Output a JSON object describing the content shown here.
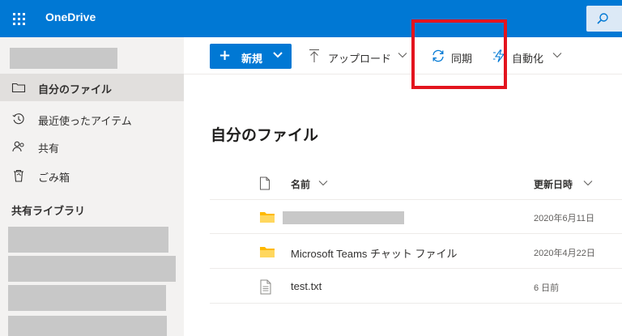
{
  "header": {
    "app_name": "OneDrive"
  },
  "sidebar": {
    "items": [
      {
        "label": "自分のファイル",
        "icon": "folder-icon",
        "active": true
      },
      {
        "label": "最近使ったアイテム",
        "icon": "history-icon",
        "active": false
      },
      {
        "label": "共有",
        "icon": "people-icon",
        "active": false
      },
      {
        "label": "ごみ箱",
        "icon": "trash-icon",
        "active": false
      }
    ],
    "shared_libraries_title": "共有ライブラリ"
  },
  "command_bar": {
    "new_label": "新規",
    "upload_label": "アップロード",
    "sync_label": "同期",
    "automate_label": "自動化"
  },
  "main": {
    "title": "自分のファイル",
    "columns": {
      "name": "名前",
      "modified": "更新日時"
    },
    "rows": [
      {
        "name": "",
        "date": "2020年6月11日",
        "type": "folder",
        "redacted": true
      },
      {
        "name": "Microsoft Teams チャット ファイル",
        "date": "2020年4月22日",
        "type": "folder",
        "redacted": false
      },
      {
        "name": "test.txt",
        "date": "6 日前",
        "type": "text-file",
        "redacted": false
      }
    ]
  },
  "colors": {
    "brand_blue": "#0078d4",
    "sidebar_bg": "#f3f2f1",
    "highlight_red": "#e3141e",
    "folder_yellow": "#ffb900"
  }
}
